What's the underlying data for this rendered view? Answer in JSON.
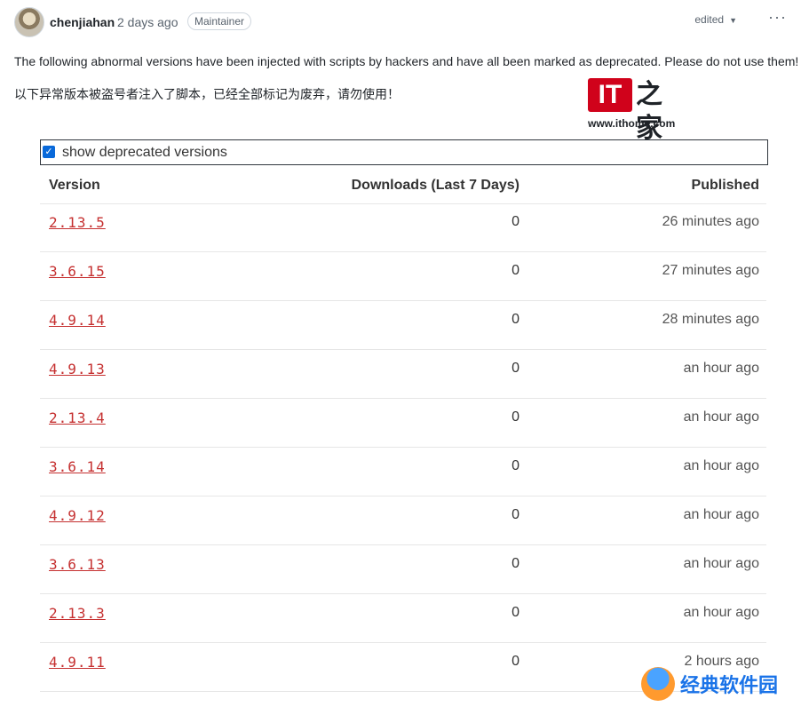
{
  "comment": {
    "username": "chenjiahan",
    "time": "2 days ago",
    "badge": "Maintainer",
    "edited_label": "edited",
    "more_label": "···",
    "message_en": "The following abnormal versions have been injected with scripts by hackers and have all been marked as deprecated. Please do not use them!",
    "message_zh": "以下异常版本被盗号者注入了脚本，已经全部标记为废弃，请勿使用！"
  },
  "logo": {
    "mark": "IT",
    "zh": "之家",
    "url": "www.ithome.com"
  },
  "versions_table": {
    "checkbox_label": "show deprecated versions",
    "checkbox_checked": true,
    "headers": [
      "Version",
      "Downloads (Last 7 Days)",
      "Published"
    ],
    "rows": [
      {
        "version": "2.13.5",
        "downloads": "0",
        "published": "26 minutes ago"
      },
      {
        "version": "3.6.15",
        "downloads": "0",
        "published": "27 minutes ago"
      },
      {
        "version": "4.9.14",
        "downloads": "0",
        "published": "28 minutes ago"
      },
      {
        "version": "4.9.13",
        "downloads": "0",
        "published": "an hour ago"
      },
      {
        "version": "2.13.4",
        "downloads": "0",
        "published": "an hour ago"
      },
      {
        "version": "3.6.14",
        "downloads": "0",
        "published": "an hour ago"
      },
      {
        "version": "4.9.12",
        "downloads": "0",
        "published": "an hour ago"
      },
      {
        "version": "3.6.13",
        "downloads": "0",
        "published": "an hour ago"
      },
      {
        "version": "2.13.3",
        "downloads": "0",
        "published": "an hour ago"
      },
      {
        "version": "4.9.11",
        "downloads": "0",
        "published": "2 hours ago"
      }
    ]
  },
  "watermark": {
    "text": "经典软件园"
  },
  "colors": {
    "version_link": "#c53030",
    "logo_red": "#d0021b",
    "checkbox_blue": "#0969da"
  }
}
